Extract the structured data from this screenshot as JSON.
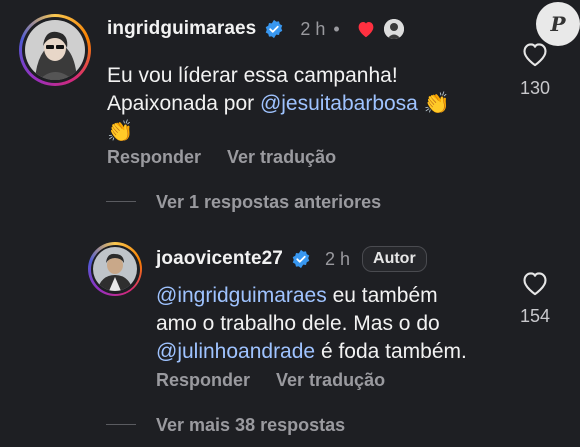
{
  "watermark": {
    "letter": "P"
  },
  "comment1": {
    "username": "ingridguimaraes",
    "time": "2 h",
    "dot": "•",
    "line1": "Eu vou líderar essa campanha!",
    "line2_prefix": "Apaixonada por ",
    "mention": "@jesuitabarbosa",
    "emoji": "👏",
    "likes": "130",
    "reply": "Responder",
    "translate": "Ver tradução"
  },
  "previous_replies": "Ver 1 respostas anteriores",
  "comment2": {
    "username": "joaovicente27",
    "time": "2 h",
    "badge": "Autor",
    "mention1": "@ingridguimaraes",
    "text1": " eu também",
    "line2": "amo o trabalho dele. Mas o do",
    "mention2": "@julinhoandrade",
    "text3": " é foda também.",
    "likes": "154",
    "reply": "Responder",
    "translate": "Ver tradução"
  },
  "more_replies": "Ver mais 38 respostas",
  "colors": {
    "background": "#1e1f23",
    "mention": "#9fc3ff",
    "verified": "#3897f0",
    "heart": "#ff3040",
    "muted": "#9a9a9f"
  }
}
